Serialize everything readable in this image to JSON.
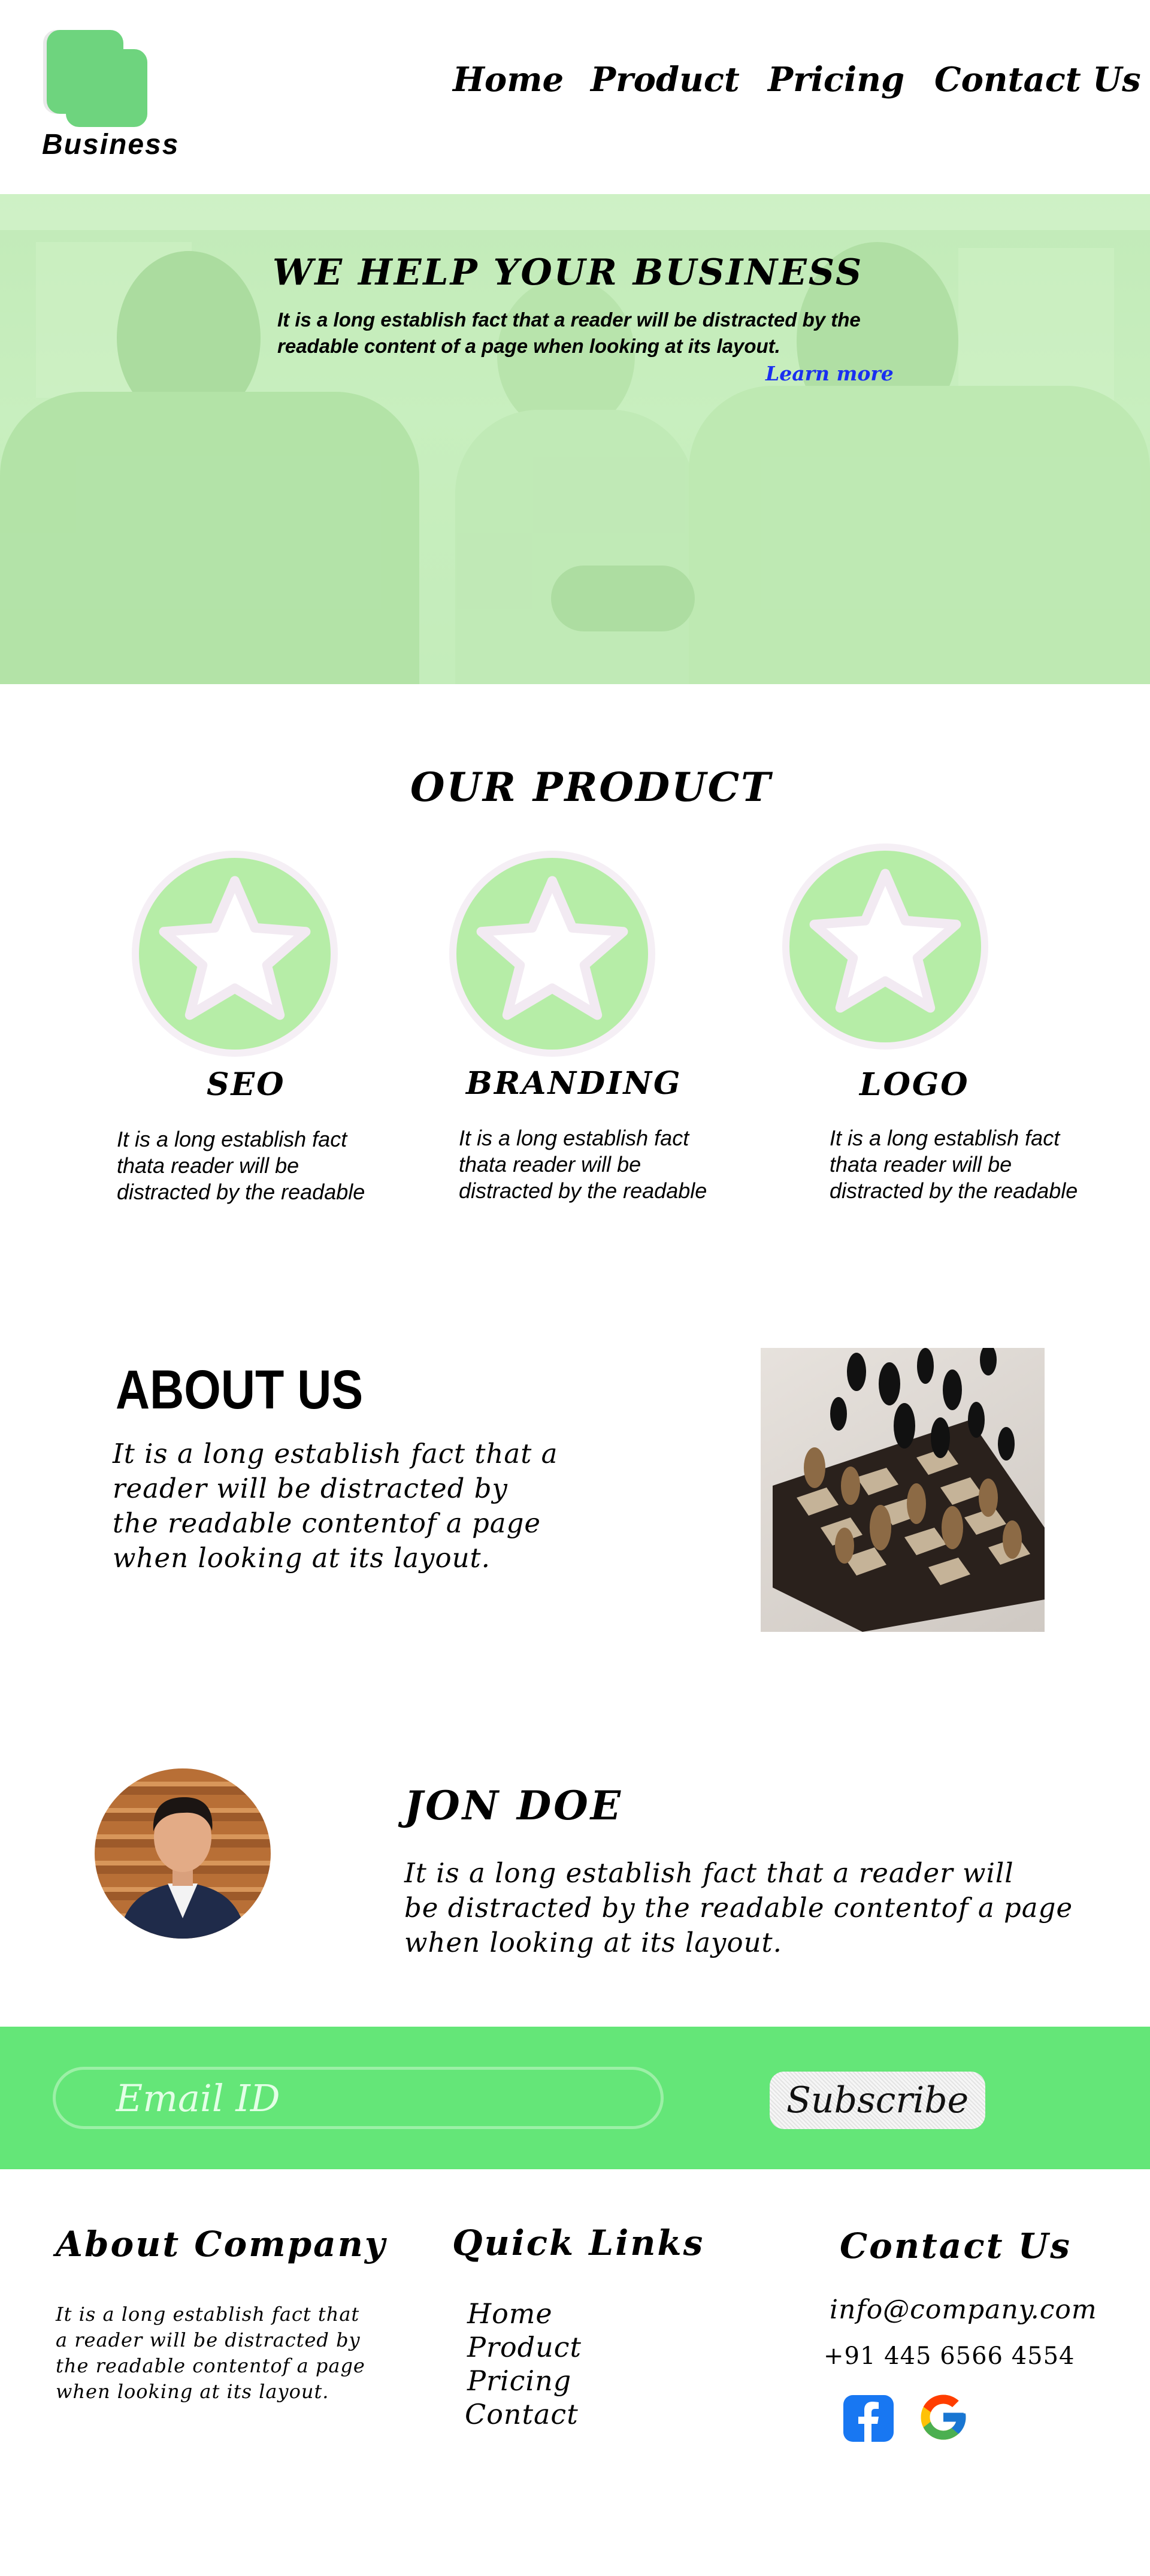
{
  "header": {
    "logo_text": "Business",
    "nav": [
      {
        "label": "Home"
      },
      {
        "label": "Product"
      },
      {
        "label": "Pricing"
      },
      {
        "label": "Contact Us"
      }
    ]
  },
  "hero": {
    "title": "WE HELP YOUR BUSINESS",
    "text": "It is a long establish fact that a reader will be distracted by the readable content of a page when looking at its layout.",
    "link": "Learn more"
  },
  "products": {
    "title": "OUR PRODUCT",
    "items": [
      {
        "title": "SEO",
        "text": "It is a long establish fact\n thata reader will be\ndistracted by the readable",
        "icon": "star-icon"
      },
      {
        "title": "BRANDING",
        "text": "It is a long establish fact\n thata reader will be\ndistracted by the readable",
        "icon": "star-icon"
      },
      {
        "title": "LOGO",
        "text": "It is a long establish fact\n thata reader will be\ndistracted by the readable",
        "icon": "star-icon"
      }
    ]
  },
  "about": {
    "title": "ABOUT US",
    "text": "It is a long establish fact that a\nreader will be distracted by\nthe readable contentof a page\nwhen looking at its layout."
  },
  "profile": {
    "name": "JON DOE",
    "text": "It is a long establish fact that a reader will\nbe distracted by the readable contentof a page\nwhen looking at its layout."
  },
  "subscribe": {
    "placeholder": "Email ID",
    "button": "Subscribe"
  },
  "footer": {
    "about_title": "About Company",
    "about_text": "It is a long establish fact that\n a reader will be distracted by\nthe readable contentof a page\nwhen looking at its layout.",
    "links_title": "Quick Links",
    "links": [
      "Home",
      "Product",
      "Pricing",
      "Contact"
    ],
    "contact_title": "Contact Us",
    "email": "info@company.com",
    "phone": "+91 445 6566 4554"
  },
  "colors": {
    "brand_green": "#64e678",
    "hero_tint": "#c2ebba",
    "product_circle": "#b6eda7",
    "link_blue": "#1a2ff0"
  }
}
